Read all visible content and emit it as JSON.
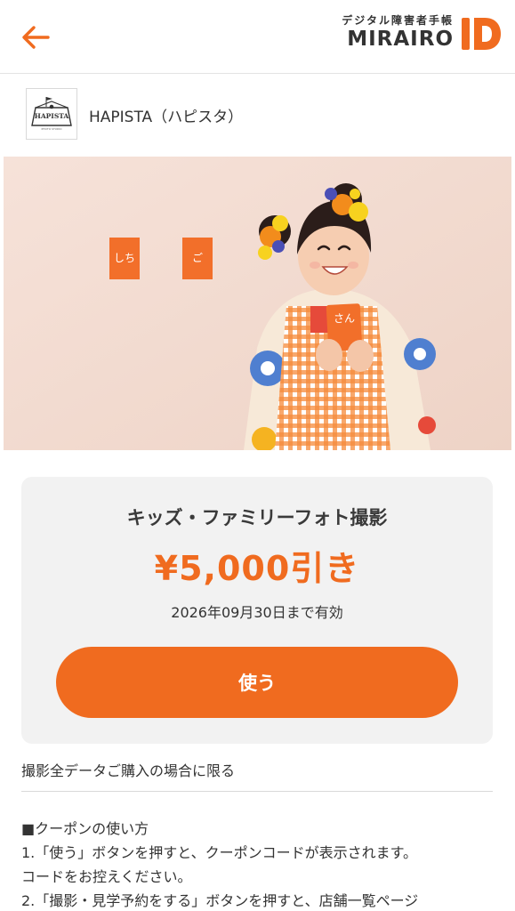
{
  "header": {
    "back_label": "戻る",
    "brand_sub": "デジタル障害者手帳",
    "brand_name": "MIRAIRO",
    "brand_id": "ID",
    "accent_color": "#f06b1f"
  },
  "shop": {
    "name": "HAPISTA（ハピスタ）",
    "logo_text": "HAPISTA",
    "logo_subtext": "PHOTO STUDIO"
  },
  "hero": {
    "cards": [
      "しち",
      "ご",
      "さん"
    ]
  },
  "coupon": {
    "title": "キッズ・ファミリーフォト撮影",
    "discount": "¥5,000引き",
    "validity": "2026年09月30日まで有効",
    "use_button_label": "使う"
  },
  "condition": "撮影全データご購入の場合に限る",
  "usage": {
    "heading": "■クーポンの使い方",
    "lines": [
      "1.「使う」ボタンを押すと、クーポンコードが表示されます。",
      "コードをお控えください。",
      "2.「撮影・見学予約をする」ボタンを押すと、店舗一覧ページ"
    ]
  }
}
